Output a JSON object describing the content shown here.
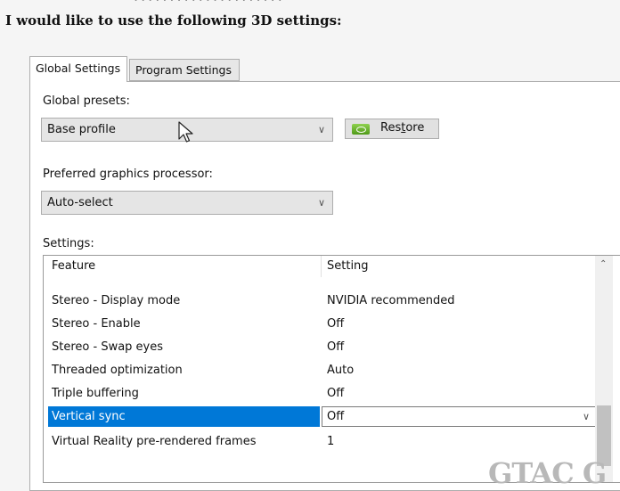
{
  "heading": "I would like to use the following 3D settings:",
  "tabs": [
    {
      "label": "Global Settings"
    },
    {
      "label": "Program Settings"
    }
  ],
  "global_presets": {
    "label": "Global presets:",
    "value": "Base profile",
    "restore_label_pre": "Res",
    "restore_label_u": "t",
    "restore_label_post": "ore"
  },
  "preferred_gpu": {
    "label": "Preferred graphics processor:",
    "value": "Auto-select"
  },
  "settings": {
    "label": "Settings:",
    "col_feature": "Feature",
    "col_setting": "Setting",
    "rows": [
      {
        "feature": "Stereo - Display mode",
        "setting": "NVIDIA recommended"
      },
      {
        "feature": "Stereo - Enable",
        "setting": "Off"
      },
      {
        "feature": "Stereo - Swap eyes",
        "setting": "Off"
      },
      {
        "feature": "Threaded optimization",
        "setting": "Auto"
      },
      {
        "feature": "Triple buffering",
        "setting": "Off"
      },
      {
        "feature": "Vertical sync",
        "setting": "Off",
        "selected": true
      },
      {
        "feature": "Virtual Reality pre-rendered frames",
        "setting": "1"
      }
    ]
  },
  "icons": {
    "dropdown": "chevron-down-icon",
    "restore": "nvidia-logo-icon",
    "scroll_up": "scroll-up-arrow-icon",
    "cursor": "mouse-cursor-icon"
  },
  "colors": {
    "selection": "#0078d7",
    "nvidia_green": "#76b900"
  },
  "watermark": "GTAC G"
}
